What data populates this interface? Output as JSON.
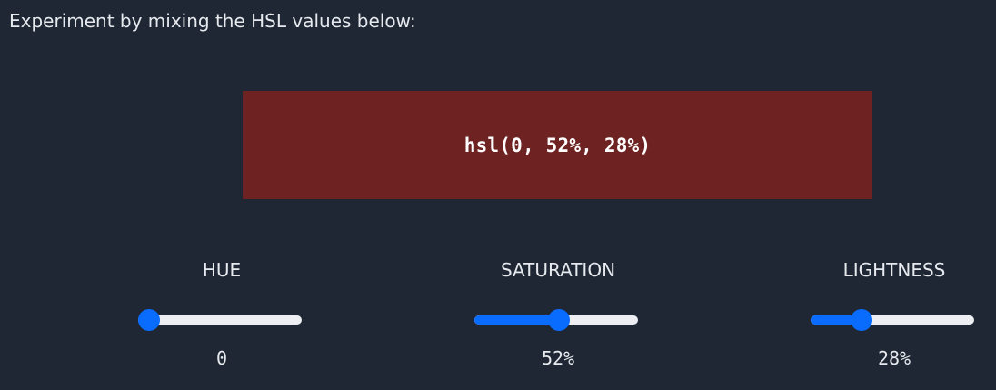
{
  "intro_text": "Experiment by mixing the HSL values below:",
  "swatch": {
    "label": "hsl(0, 52%, 28%)",
    "color": "#6e2222"
  },
  "controls": [
    {
      "title": "HUE",
      "value_text": "0",
      "fraction": 0.0
    },
    {
      "title": "SATURATION",
      "value_text": "52%",
      "fraction": 0.52
    },
    {
      "title": "LIGHTNESS",
      "value_text": "28%",
      "fraction": 0.28
    }
  ],
  "colors": {
    "background": "#1e2733",
    "accent": "#0a6cff",
    "track": "#eceef2"
  }
}
